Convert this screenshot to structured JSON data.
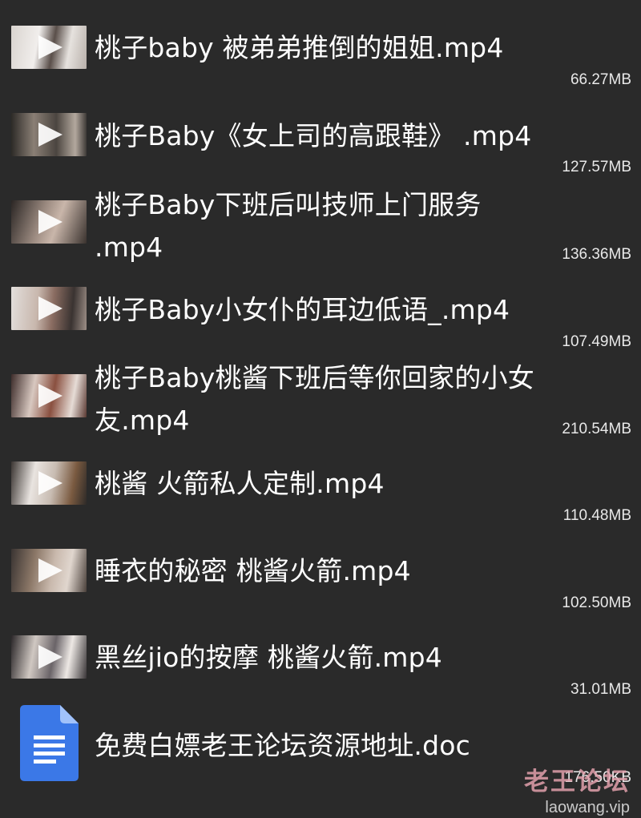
{
  "files": [
    {
      "name": "桃子baby 被弟弟推倒的姐姐.mp4",
      "size": "66.27MB",
      "type": "video",
      "thumb_colors": [
        "#d9d4cf",
        "#5a4f4a",
        "#f1eeec"
      ]
    },
    {
      "name": "桃子Baby《女上司的高跟鞋》 .mp4",
      "size": "127.57MB",
      "type": "video",
      "thumb_colors": [
        "#4b4540",
        "#8a7f75",
        "#2d2a27"
      ]
    },
    {
      "name": "桃子Baby下班后叫技师上门服务 .mp4",
      "size": "136.36MB",
      "type": "video",
      "thumb_colors": [
        "#2b2624",
        "#9b8a80",
        "#c9b6aa"
      ]
    },
    {
      "name": "桃子Baby小女仆的耳边低语_.mp4",
      "size": "107.49MB",
      "type": "video",
      "thumb_colors": [
        "#e3dfdc",
        "#8b6d62",
        "#3a3331"
      ]
    },
    {
      "name": "桃子Baby桃酱下班后等你回家的小女友.mp4",
      "size": "210.54MB",
      "type": "video",
      "thumb_colors": [
        "#3d2c2a",
        "#8a5040",
        "#d8c8c0"
      ]
    },
    {
      "name": "桃酱 火箭私人定制.mp4",
      "size": "110.48MB",
      "type": "video",
      "thumb_colors": [
        "#e9e4e0",
        "#7a5a40",
        "#3b3532"
      ]
    },
    {
      "name": "睡衣的秘密 桃酱火箭.mp4",
      "size": "102.50MB",
      "type": "video",
      "thumb_colors": [
        "#3a3432",
        "#c9b9ad",
        "#8b7767"
      ]
    },
    {
      "name": "黑丝jio的按摩 桃酱火箭.mp4",
      "size": "31.01MB",
      "type": "video",
      "thumb_colors": [
        "#d0c8c2",
        "#6a6468",
        "#2a2628"
      ]
    },
    {
      "name": "免费白嫖老王论坛资源地址.doc",
      "size": "176.50KB",
      "type": "doc",
      "icon": "google-docs-icon",
      "doc_color": "#3b78e7"
    }
  ],
  "watermark": {
    "main": "老王论坛",
    "sub": "laowang.vip"
  },
  "colors": {
    "background": "#2a2a2a",
    "text": "#ffffff",
    "play_icon": "#ffffff"
  }
}
